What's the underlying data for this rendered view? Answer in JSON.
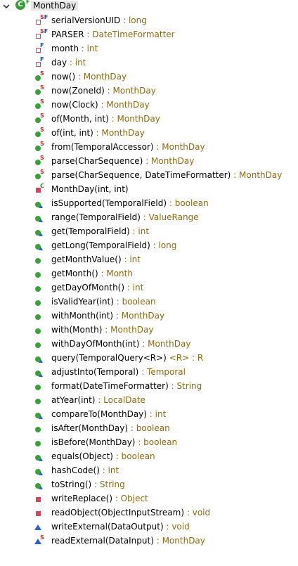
{
  "root": {
    "label": "MonthDay",
    "modifier": "F",
    "icon": "class-icon"
  },
  "members": [
    {
      "sig": "serialVersionUID",
      "ret": " : long",
      "icon": "private-field-icon",
      "kind": "sq-priv-hollow",
      "mods": [
        "S",
        "F"
      ]
    },
    {
      "sig": "PARSER",
      "ret": " : DateTimeFormatter",
      "icon": "private-field-icon",
      "kind": "sq-priv-hollow",
      "mods": [
        "S",
        "F"
      ]
    },
    {
      "sig": "month",
      "ret": " : int",
      "icon": "private-field-icon",
      "kind": "sq-priv-hollow",
      "mods": [
        "F"
      ]
    },
    {
      "sig": "day",
      "ret": " : int",
      "icon": "private-field-icon",
      "kind": "sq-priv-hollow",
      "mods": [
        "F"
      ]
    },
    {
      "sig": "now()",
      "ret": " : MonthDay",
      "icon": "public-method-icon",
      "kind": "circle-pub",
      "mods": [
        "S"
      ]
    },
    {
      "sig": "now(ZoneId)",
      "ret": " : MonthDay",
      "icon": "public-method-icon",
      "kind": "circle-pub",
      "mods": [
        "S"
      ]
    },
    {
      "sig": "now(Clock)",
      "ret": " : MonthDay",
      "icon": "public-method-icon",
      "kind": "circle-pub",
      "mods": [
        "S"
      ]
    },
    {
      "sig": "of(Month, int)",
      "ret": " : MonthDay",
      "icon": "public-method-icon",
      "kind": "circle-pub",
      "mods": [
        "S"
      ]
    },
    {
      "sig": "of(int, int)",
      "ret": " : MonthDay",
      "icon": "public-method-icon",
      "kind": "circle-pub",
      "mods": [
        "S"
      ]
    },
    {
      "sig": "from(TemporalAccessor)",
      "ret": " : MonthDay",
      "icon": "public-method-icon",
      "kind": "circle-pub",
      "mods": [
        "S"
      ]
    },
    {
      "sig": "parse(CharSequence)",
      "ret": " : MonthDay",
      "icon": "public-method-icon",
      "kind": "circle-pub",
      "mods": [
        "S"
      ]
    },
    {
      "sig": "parse(CharSequence, DateTimeFormatter)",
      "ret": " : MonthDay",
      "icon": "public-method-icon",
      "kind": "circle-pub",
      "mods": [
        "S"
      ]
    },
    {
      "sig": "MonthDay(int, int)",
      "ret": "",
      "icon": "private-constructor-icon",
      "kind": "sq-priv",
      "mods": [
        "C"
      ]
    },
    {
      "sig": "isSupported(TemporalField)",
      "ret": " : boolean",
      "icon": "public-method-icon",
      "kind": "circle-pub",
      "mods": [],
      "override": true
    },
    {
      "sig": "range(TemporalField)",
      "ret": " : ValueRange",
      "icon": "public-method-icon",
      "kind": "circle-pub",
      "mods": [],
      "override": true
    },
    {
      "sig": "get(TemporalField)",
      "ret": " : int",
      "icon": "public-method-icon",
      "kind": "circle-pub",
      "mods": [],
      "override": true
    },
    {
      "sig": "getLong(TemporalField)",
      "ret": " : long",
      "icon": "public-method-icon",
      "kind": "circle-pub",
      "mods": [],
      "override": true
    },
    {
      "sig": "getMonthValue()",
      "ret": " : int",
      "icon": "public-method-icon",
      "kind": "circle-pub",
      "mods": []
    },
    {
      "sig": "getMonth()",
      "ret": " : Month",
      "icon": "public-method-icon",
      "kind": "circle-pub",
      "mods": []
    },
    {
      "sig": "getDayOfMonth()",
      "ret": " : int",
      "icon": "public-method-icon",
      "kind": "circle-pub",
      "mods": []
    },
    {
      "sig": "isValidYear(int)",
      "ret": " : boolean",
      "icon": "public-method-icon",
      "kind": "circle-pub",
      "mods": []
    },
    {
      "sig": "withMonth(int)",
      "ret": " : MonthDay",
      "icon": "public-method-icon",
      "kind": "circle-pub",
      "mods": []
    },
    {
      "sig": "with(Month)",
      "ret": " : MonthDay",
      "icon": "public-method-icon",
      "kind": "circle-pub",
      "mods": []
    },
    {
      "sig": "withDayOfMonth(int)",
      "ret": " : MonthDay",
      "icon": "public-method-icon",
      "kind": "circle-pub",
      "mods": []
    },
    {
      "sig": "query(TemporalQuery<R>)",
      "gen": " <R>",
      "ret": " : R",
      "icon": "public-method-icon",
      "kind": "circle-pub",
      "mods": [],
      "override": true
    },
    {
      "sig": "adjustInto(Temporal)",
      "ret": " : Temporal",
      "icon": "public-method-icon",
      "kind": "circle-pub",
      "mods": [],
      "override": true
    },
    {
      "sig": "format(DateTimeFormatter)",
      "ret": " : String",
      "icon": "public-method-icon",
      "kind": "circle-pub",
      "mods": []
    },
    {
      "sig": "atYear(int)",
      "ret": " : LocalDate",
      "icon": "public-method-icon",
      "kind": "circle-pub",
      "mods": []
    },
    {
      "sig": "compareTo(MonthDay)",
      "ret": " : int",
      "icon": "public-method-icon",
      "kind": "circle-pub",
      "mods": [],
      "override": true
    },
    {
      "sig": "isAfter(MonthDay)",
      "ret": " : boolean",
      "icon": "public-method-icon",
      "kind": "circle-pub",
      "mods": []
    },
    {
      "sig": "isBefore(MonthDay)",
      "ret": " : boolean",
      "icon": "public-method-icon",
      "kind": "circle-pub",
      "mods": []
    },
    {
      "sig": "equals(Object)",
      "ret": " : boolean",
      "icon": "public-method-icon",
      "kind": "circle-pub",
      "mods": [],
      "override": true
    },
    {
      "sig": "hashCode()",
      "ret": " : int",
      "icon": "public-method-icon",
      "kind": "circle-pub",
      "mods": [],
      "override": true
    },
    {
      "sig": "toString()",
      "ret": " : String",
      "icon": "public-method-icon",
      "kind": "circle-pub",
      "mods": [],
      "override": true
    },
    {
      "sig": "writeReplace()",
      "ret": " : Object",
      "icon": "private-method-icon",
      "kind": "sq-priv",
      "mods": []
    },
    {
      "sig": "readObject(ObjectInputStream)",
      "ret": " : void",
      "icon": "private-method-icon",
      "kind": "sq-priv",
      "mods": []
    },
    {
      "sig": "writeExternal(DataOutput)",
      "ret": " : void",
      "icon": "protected-method-icon",
      "kind": "tri-prot",
      "mods": []
    },
    {
      "sig": "readExternal(DataInput)",
      "ret": " : MonthDay",
      "icon": "protected-method-icon",
      "kind": "tri-prot",
      "mods": [
        "S"
      ]
    }
  ]
}
